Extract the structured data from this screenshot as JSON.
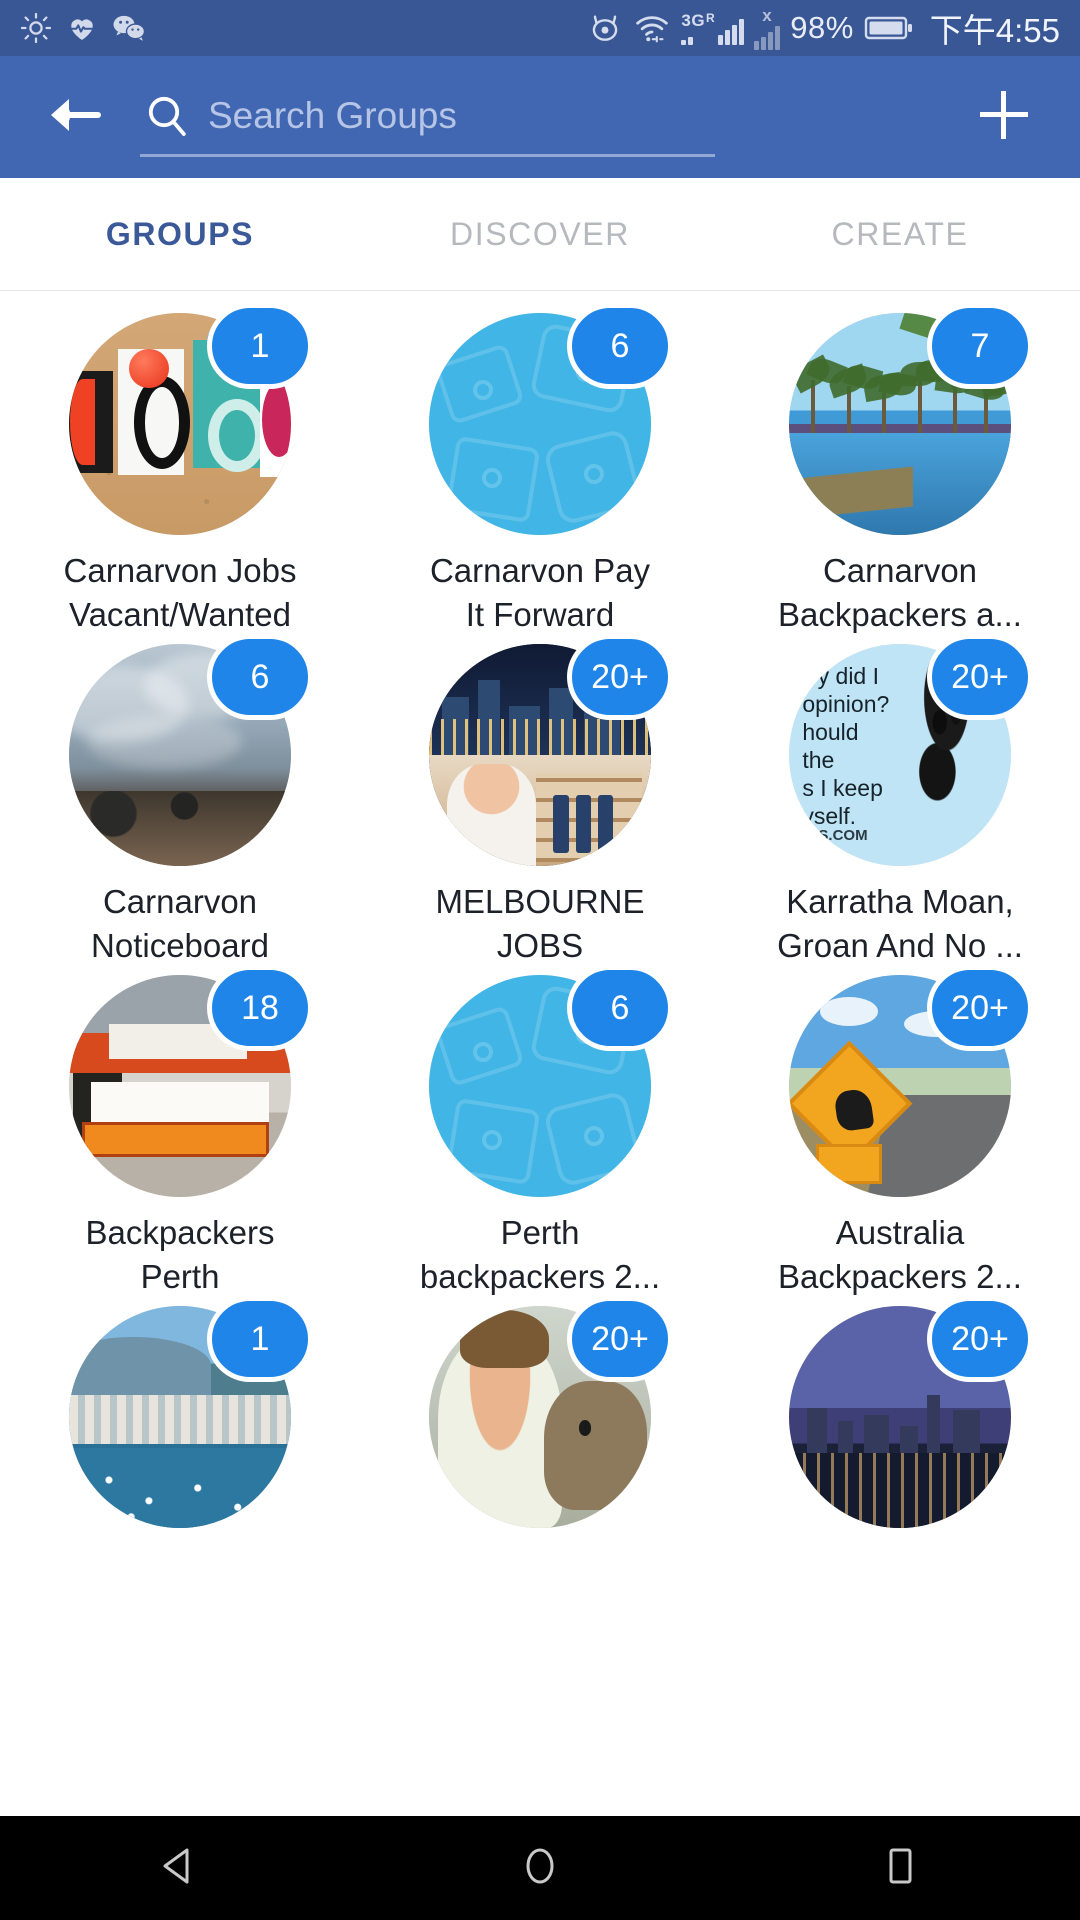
{
  "status_bar": {
    "left_icons": [
      "brightness-icon",
      "heart-rate-icon",
      "wechat-icon"
    ],
    "right_icons": [
      "eye-comfort-icon",
      "wifi-icon",
      "signal-3g-icon",
      "signal-no-sim-icon"
    ],
    "network_label": "3G",
    "roaming_label": "R",
    "no_sim_label": "x",
    "battery_percent": "98%",
    "clock": "下午4:55"
  },
  "header": {
    "back_icon": "back-arrow-icon",
    "search_icon": "search-icon",
    "search_value": "",
    "search_placeholder": "Search Groups",
    "add_icon": "plus-icon"
  },
  "tabs": [
    {
      "label": "GROUPS",
      "active": true
    },
    {
      "label": "DISCOVER",
      "active": false
    },
    {
      "label": "CREATE",
      "active": false
    }
  ],
  "colors": {
    "status_bar_bg": "#3a5795",
    "header_bg": "#4267b2",
    "tab_active": "#3b5998",
    "tab_inactive": "#b5b8bd",
    "badge_bg": "#1f85e8",
    "badge_text": "#ffffff",
    "label_text": "#1d2129",
    "page_bg": "#ffffff",
    "nav_bg": "#000000"
  },
  "groups": [
    {
      "name": "Carnarvon Jobs Vacant/Wanted",
      "line1": "Carnarvon Jobs",
      "line2": "Vacant/Wanted",
      "badge": "1",
      "art": "art-jobs"
    },
    {
      "name": "Carnarvon Pay It Forward",
      "line1": "Carnarvon Pay",
      "line2": "It Forward",
      "badge": "6",
      "art": "art-fb-default"
    },
    {
      "name": "Carnarvon Backpackers a...",
      "line1": "Carnarvon",
      "line2": "Backpackers a...",
      "badge": "7",
      "art": "art-palms"
    },
    {
      "name": "Carnarvon Noticeboard",
      "line1": "Carnarvon",
      "line2": "Noticeboard",
      "badge": "6",
      "art": "art-storm"
    },
    {
      "name": "MELBOURNE JOBS",
      "line1": "MELBOURNE",
      "line2": "JOBS",
      "badge": "20+",
      "art": "art-melb"
    },
    {
      "name": "Karratha Moan, Groan And No ...",
      "line1": "Karratha Moan,",
      "line2": "Groan And No ...",
      "badge": "20+",
      "art": "art-meme"
    },
    {
      "name": "Backpackers Perth",
      "line1": "Backpackers",
      "line2": "Perth",
      "badge": "18",
      "art": "art-travel"
    },
    {
      "name": "Perth backpackers 2...",
      "line1": "Perth",
      "line2": "backpackers 2...",
      "badge": "6",
      "art": "art-fb-default"
    },
    {
      "name": "Australia Backpackers 2...",
      "line1": "Australia",
      "line2": "Backpackers 2...",
      "badge": "20+",
      "art": "art-road"
    },
    {
      "name": "",
      "line1": "",
      "line2": "",
      "badge": "1",
      "art": "art-cairns"
    },
    {
      "name": "",
      "line1": "",
      "line2": "",
      "badge": "20+",
      "art": "art-quokka"
    },
    {
      "name": "",
      "line1": "",
      "line2": "",
      "badge": "20+",
      "art": "art-perthcity"
    }
  ],
  "meme_text": {
    "line1": "rry did I",
    "line2": "opinion?",
    "line3": "hould",
    "line4": "the",
    "line5": "s I keep",
    "line6": "yself.",
    "source": "OS.COM"
  },
  "nav_bar": {
    "back_icon": "nav-back-triangle-icon",
    "home_icon": "nav-home-circle-icon",
    "recents_icon": "nav-recents-square-icon"
  }
}
